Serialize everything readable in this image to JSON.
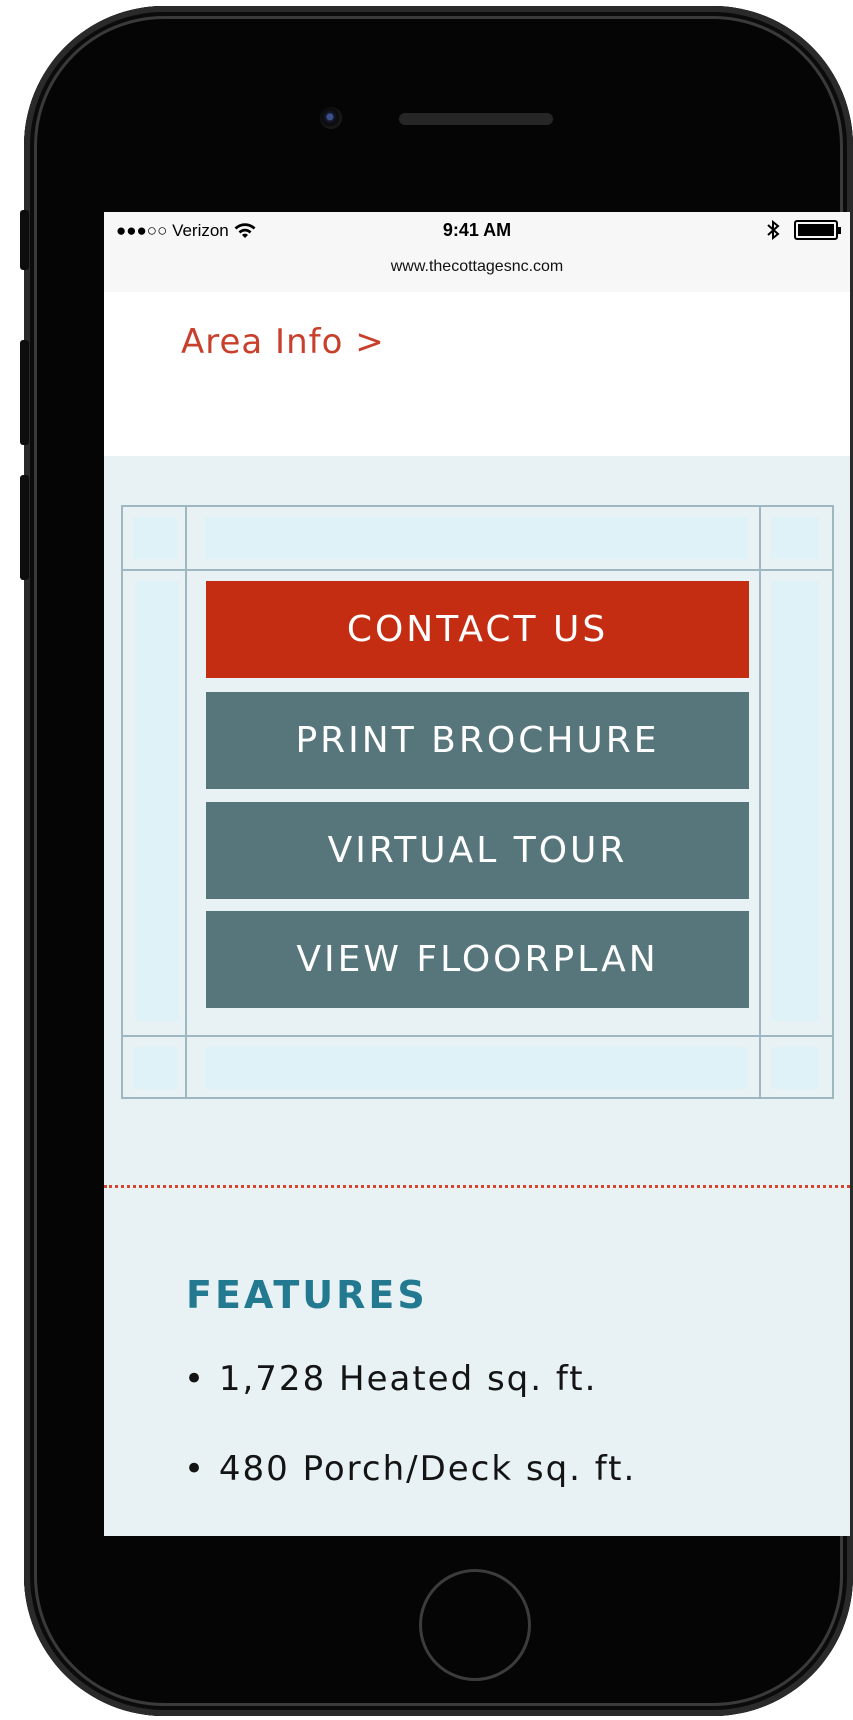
{
  "status_bar": {
    "carrier": "●●●○○ Verizon",
    "time": "9:41 AM",
    "bluetooth_icon": "bluetooth-icon",
    "wifi_icon": "wifi-icon",
    "battery_level": 1.0
  },
  "browser": {
    "url": "www.thecottagesnc.com"
  },
  "page": {
    "area_info_link": "Area Info >",
    "buttons": {
      "contact": "CONTACT US",
      "print": "PRINT BROCHURE",
      "tour": "VIRTUAL TOUR",
      "floorplan": "VIEW FLOORPLAN"
    },
    "features": {
      "title": "FEATURES",
      "items": [
        "• 1,728 Heated sq. ft.",
        "• 480 Porch/Deck sq. ft."
      ]
    }
  },
  "colors": {
    "accent_red": "#c52d12",
    "button_teal": "#56767c",
    "heading_teal": "#227990",
    "link_red": "#c8402c",
    "background": "#e8f2f5"
  }
}
